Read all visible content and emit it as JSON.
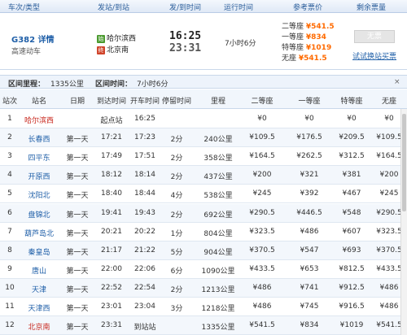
{
  "header": {
    "col_train": "车次/类型",
    "col_stations": "发站/到站",
    "col_times": "发/到时间",
    "col_duration": "运行时间",
    "col_fare": "参考票价",
    "col_remaining": "剩余票量"
  },
  "train": {
    "code": "G382 详情",
    "type": "高速动车",
    "from_tag": "始",
    "from_station": "哈尔滨西",
    "to_tag": "终",
    "to_station": "北京南",
    "depart_time": "16:25",
    "arrive_time": "23:31",
    "duration": "7小时6分",
    "fares": [
      {
        "label": "二等座",
        "price": "¥541.5"
      },
      {
        "label": "一等座",
        "price": "¥834"
      },
      {
        "label": "特等座",
        "price": "¥1019"
      },
      {
        "label": "无座",
        "price": "¥541.5"
      }
    ],
    "book_button": "无票",
    "try_link": "试试换站买票"
  },
  "interval": {
    "distance_label": "区间里程：",
    "distance": "1335公里",
    "time_label": "区间时间：",
    "time": "7小时6分",
    "close": "×"
  },
  "table": {
    "columns": [
      "站次",
      "站名",
      "日期",
      "到达时间",
      "开车时间",
      "停留时间",
      "里程",
      "二等座",
      "一等座",
      "特等座",
      "无座"
    ],
    "rows": [
      [
        "1",
        "哈尔滨西",
        "",
        "起点站",
        "16:25",
        "",
        "",
        "¥0",
        "¥0",
        "¥0",
        "¥0"
      ],
      [
        "2",
        "长春西",
        "第一天",
        "17:21",
        "17:23",
        "2分",
        "240公里",
        "¥109.5",
        "¥176.5",
        "¥209.5",
        "¥109.5"
      ],
      [
        "3",
        "四平东",
        "第一天",
        "17:49",
        "17:51",
        "2分",
        "358公里",
        "¥164.5",
        "¥262.5",
        "¥312.5",
        "¥164.5"
      ],
      [
        "4",
        "开原西",
        "第一天",
        "18:12",
        "18:14",
        "2分",
        "437公里",
        "¥200",
        "¥321",
        "¥381",
        "¥200"
      ],
      [
        "5",
        "沈阳北",
        "第一天",
        "18:40",
        "18:44",
        "4分",
        "538公里",
        "¥245",
        "¥392",
        "¥467",
        "¥245"
      ],
      [
        "6",
        "盘锦北",
        "第一天",
        "19:41",
        "19:43",
        "2分",
        "692公里",
        "¥290.5",
        "¥446.5",
        "¥548",
        "¥290.5"
      ],
      [
        "7",
        "葫芦岛北",
        "第一天",
        "20:21",
        "20:22",
        "1分",
        "804公里",
        "¥323.5",
        "¥486",
        "¥607",
        "¥323.5"
      ],
      [
        "8",
        "秦皇岛",
        "第一天",
        "21:17",
        "21:22",
        "5分",
        "904公里",
        "¥370.5",
        "¥547",
        "¥693",
        "¥370.5"
      ],
      [
        "9",
        "唐山",
        "第一天",
        "22:00",
        "22:06",
        "6分",
        "1090公里",
        "¥433.5",
        "¥653",
        "¥812.5",
        "¥433.5"
      ],
      [
        "10",
        "天津",
        "第一天",
        "22:52",
        "22:54",
        "2分",
        "1213公里",
        "¥486",
        "¥741",
        "¥912.5",
        "¥486"
      ],
      [
        "11",
        "天津西",
        "第一天",
        "23:01",
        "23:04",
        "3分",
        "1218公里",
        "¥486",
        "¥745",
        "¥916.5",
        "¥486"
      ],
      [
        "12",
        "北京南",
        "第一天",
        "23:31",
        "到站站",
        "",
        "1335公里",
        "¥541.5",
        "¥834",
        "¥1019",
        "¥541.5"
      ]
    ]
  },
  "colors": {
    "link_blue": "#1f5fa8",
    "fare_orange": "#ff6a00",
    "header_blue": "#edf3fb"
  }
}
